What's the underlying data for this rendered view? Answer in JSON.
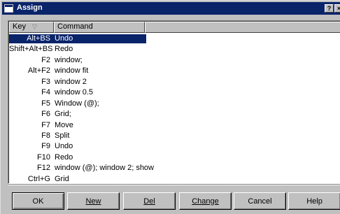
{
  "window": {
    "title": "Assign",
    "help_button": "?",
    "close_button": "×"
  },
  "list": {
    "columns": {
      "key": "Key",
      "command": "Command"
    },
    "sort_indicator": "▽",
    "rows": [
      {
        "key": "Alt+BS",
        "command": "Undo",
        "selected": true
      },
      {
        "key": "Shift+Alt+BS",
        "command": "Redo",
        "selected": false
      },
      {
        "key": "F2",
        "command": "window;",
        "selected": false
      },
      {
        "key": "Alt+F2",
        "command": "window fit",
        "selected": false
      },
      {
        "key": "F3",
        "command": "window 2",
        "selected": false
      },
      {
        "key": "F4",
        "command": "window 0.5",
        "selected": false
      },
      {
        "key": "F5",
        "command": "Window (@);",
        "selected": false
      },
      {
        "key": "F6",
        "command": "Grid;",
        "selected": false
      },
      {
        "key": "F7",
        "command": "Move",
        "selected": false
      },
      {
        "key": "F8",
        "command": "Split",
        "selected": false
      },
      {
        "key": "F9",
        "command": "Undo",
        "selected": false
      },
      {
        "key": "F10",
        "command": "Redo",
        "selected": false
      },
      {
        "key": "F12",
        "command": "window (@); window 2; show",
        "selected": false
      },
      {
        "key": "Ctrl+G",
        "command": "Grid",
        "selected": false
      }
    ]
  },
  "buttons": {
    "ok": "OK",
    "new": "New",
    "del": "Del",
    "change": "Change",
    "cancel": "Cancel",
    "help": "Help"
  },
  "colors": {
    "selection": "#0a246a",
    "titlebar": "#0a246a",
    "face": "#c0c0c0"
  }
}
